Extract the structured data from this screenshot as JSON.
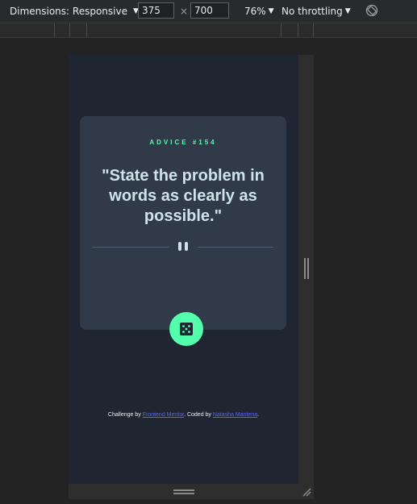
{
  "devtools": {
    "dimensions_label": "Dimensions: Responsive",
    "width": "375",
    "height": "700",
    "times": "×",
    "zoom": "76%",
    "throttling": "No throttling",
    "caret": "▼"
  },
  "card": {
    "advice_id": "ADVICE #154",
    "quote": "\"State the problem in words as clearly as possible.\""
  },
  "footer": {
    "prefix": "Challenge by ",
    "link1": "Frontend Mentor",
    "middle": ". Coded by ",
    "link2": "Natasha Mantena",
    "suffix": "."
  },
  "colors": {
    "accent": "#53ffab",
    "card": "#313a49",
    "background": "#1f2632",
    "quote": "#cee3e9",
    "link": "#5865f2"
  },
  "icons": [
    "caret-down-icon",
    "rotate-icon",
    "pause-divider-icon",
    "dice-icon",
    "resize-grip-icon"
  ]
}
